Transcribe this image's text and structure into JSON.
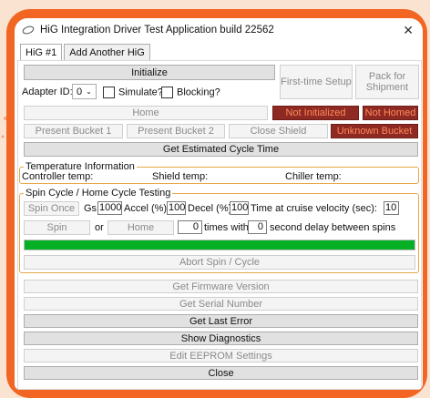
{
  "window": {
    "title": "HiG Integration Driver Test Application build 22562"
  },
  "tabs": [
    {
      "label": "HiG #1"
    },
    {
      "label": "Add Another HiG"
    }
  ],
  "top": {
    "initialize": "Initialize",
    "first_time_setup": "First-time Setup",
    "pack_for_shipment": "Pack for Shipment",
    "adapter_label": "Adapter ID:",
    "adapter_value": "0",
    "simulate_label": "Simulate?",
    "blocking_label": "Blocking?",
    "home": "Home",
    "not_initialized": "Not Initialized",
    "not_homed": "Not Homed",
    "present_bucket_1": "Present Bucket 1",
    "present_bucket_2": "Present Bucket 2",
    "close_shield": "Close Shield",
    "unknown_bucket": "Unknown Bucket",
    "get_estimated_cycle_time": "Get Estimated Cycle Time"
  },
  "temperature": {
    "title": "Temperature Information",
    "controller": "Controller temp:",
    "shield": "Shield temp:",
    "chiller": "Chiller temp:"
  },
  "spin": {
    "title": "Spin Cycle / Home Cycle Testing",
    "spin_once": "Spin Once",
    "gs_label": "Gs:",
    "gs_value": "1000",
    "accel_label": "Accel (%):",
    "accel_value": "100",
    "decel_label": "Decel (%):",
    "decel_value": "100",
    "cruise_label": "Time at cruise velocity (sec):",
    "cruise_value": "10",
    "spin": "Spin",
    "or": "or",
    "home": "Home",
    "times_value": "0",
    "times_label": "times with a",
    "delay_value": "0",
    "delay_label": "second delay between spins",
    "progress": 1.0,
    "abort": "Abort Spin / Cycle"
  },
  "bottom": {
    "firmware": "Get Firmware Version",
    "serial": "Get Serial Number",
    "last_error": "Get Last Error",
    "diagnostics": "Show Diagnostics",
    "eeprom": "Edit EEPROM Settings",
    "close": "Close"
  },
  "colors": {
    "accent": "#f26522",
    "error": "#8e2a23",
    "progress": "#06b025",
    "group_border": "#e8a74a"
  }
}
